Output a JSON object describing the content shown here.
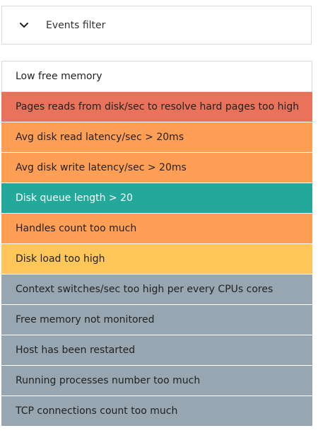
{
  "filter": {
    "label": "Events filter",
    "toggle_icon": "chevron-down-icon"
  },
  "events": [
    {
      "label": "Low free memory",
      "status": "normal",
      "color": "#ffffff"
    },
    {
      "label": "Pages reads from disk/sec to resolve hard pages too high",
      "status": "critical",
      "color": "#E8735A"
    },
    {
      "label": "Avg disk read latency/sec > 20ms",
      "status": "warning",
      "color": "#FF9F55"
    },
    {
      "label": "Avg disk write latency/sec > 20ms",
      "status": "warning",
      "color": "#FF9F55"
    },
    {
      "label": "Disk queue length > 20",
      "status": "active",
      "color": "#23A89A"
    },
    {
      "label": "Handles count too much",
      "status": "warning",
      "color": "#FF9F55"
    },
    {
      "label": "Disk load too high",
      "status": "caution",
      "color": "#FFC65A"
    },
    {
      "label": "Context switches/sec too high per every CPUs cores",
      "status": "unknown",
      "color": "#97A6B0"
    },
    {
      "label": "Free memory not monitored",
      "status": "unknown",
      "color": "#97A6B0"
    },
    {
      "label": "Host has been restarted",
      "status": "unknown",
      "color": "#97A6B0"
    },
    {
      "label": "Running processes number too much",
      "status": "unknown",
      "color": "#97A6B0"
    },
    {
      "label": "TCP connections count too much",
      "status": "unknown",
      "color": "#97A6B0"
    }
  ]
}
